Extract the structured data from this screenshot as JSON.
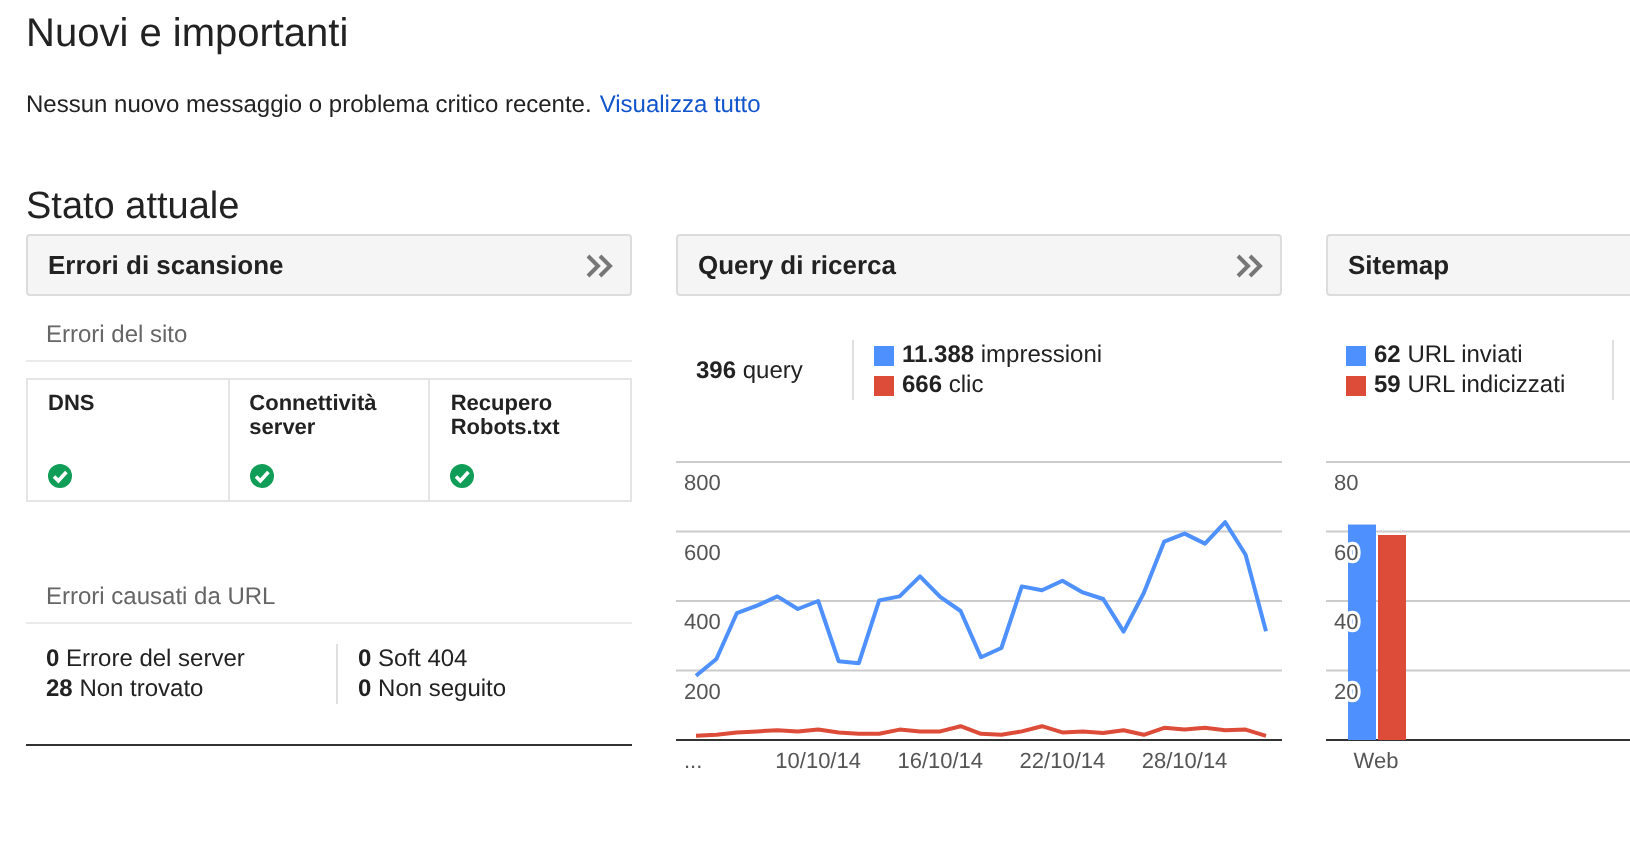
{
  "title": "Nuovi e importanti",
  "notice": {
    "text": "Nessun nuovo messaggio o problema critico recente.",
    "link": "Visualizza tutto"
  },
  "section_title": "Stato attuale",
  "panels": [
    {
      "kind": "crawl_errors",
      "title": "Errori di scansione",
      "more_arrow": true,
      "site_errors": {
        "heading": "Errori del sito",
        "checks": [
          {
            "label": "DNS",
            "ok": true
          },
          {
            "label": "Connettività server",
            "ok": true
          },
          {
            "label": "Recupero Robots.txt",
            "ok": true
          }
        ]
      },
      "url_errors": {
        "heading": "Errori causati da URL",
        "columns": [
          [
            {
              "count": "0",
              "label": "Errore del server"
            },
            {
              "count": "28",
              "label": "Non trovato"
            }
          ],
          [
            {
              "count": "0",
              "label": "Soft 404"
            },
            {
              "count": "0",
              "label": "Non seguito"
            }
          ]
        ]
      }
    },
    {
      "kind": "search_queries",
      "title": "Query di ricerca",
      "more_arrow": true,
      "summary": {
        "count": "396",
        "label": "query"
      },
      "totals": [
        "11.388",
        "666"
      ],
      "chart_data": {
        "type": "line",
        "grid": true,
        "categories": [
          "...",
          null,
          null,
          null,
          null,
          null,
          "10/10/14",
          null,
          null,
          null,
          null,
          null,
          "16/10/14",
          null,
          null,
          null,
          null,
          null,
          "22/10/14",
          null,
          null,
          null,
          null,
          null,
          "28/10/14",
          null,
          null,
          null,
          null
        ],
        "series": [
          {
            "name": "impressioni",
            "color": "#4d90fe",
            "values": [
              185,
              233,
              365,
              387,
              413,
              377,
              400,
              227,
              221,
              402,
              413,
              471,
              412,
              371,
              238,
              265,
              442,
              431,
              458,
              425,
              406,
              312,
              423,
              571,
              594,
              565,
              627,
              533,
              313
            ]
          },
          {
            "name": "clic",
            "color": "#dd4b39",
            "values": [
              12,
              15,
              22,
              25,
              28,
              25,
              30,
              22,
              18,
              18,
              30,
              25,
              25,
              40,
              18,
              15,
              25,
              40,
              22,
              25,
              20,
              28,
              15,
              35,
              30,
              35,
              28,
              30,
              12
            ]
          }
        ],
        "ylim": [
          0,
          800
        ],
        "yticks": [
          200,
          400,
          600,
          800
        ]
      }
    },
    {
      "kind": "sitemaps",
      "title": "Sitemap",
      "more_arrow": false,
      "totals": [
        "62",
        "59"
      ],
      "chart_data": {
        "type": "bar",
        "grid": true,
        "categories": [
          "Web"
        ],
        "series": [
          {
            "name": "URL inviati",
            "color": "#4d90fe",
            "values": [
              62
            ]
          },
          {
            "name": "URL indicizzati",
            "color": "#dd4b39",
            "values": [
              59
            ]
          }
        ],
        "ylim": [
          0,
          80
        ],
        "yticks": [
          20,
          40,
          60,
          80
        ]
      }
    }
  ]
}
